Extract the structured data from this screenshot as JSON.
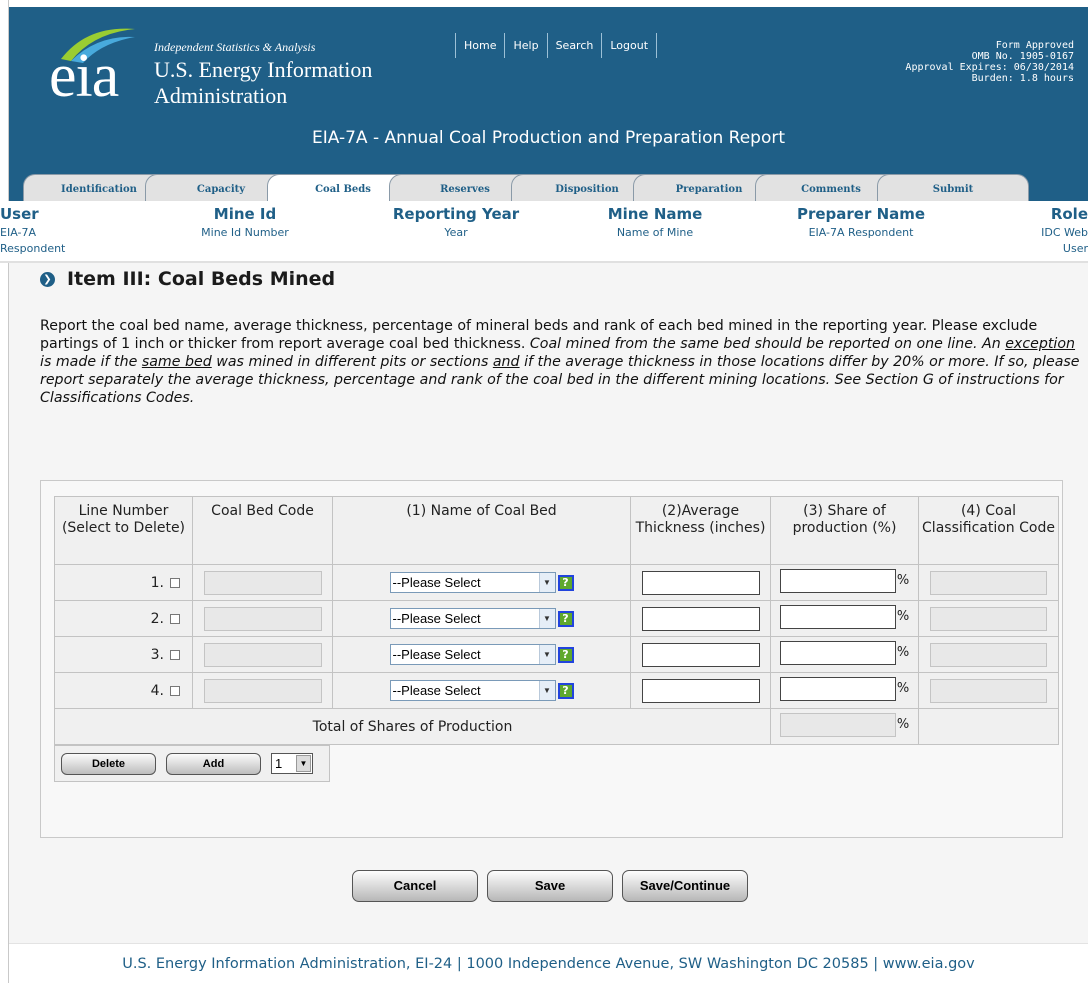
{
  "header": {
    "tagline": "Independent Statistics & Analysis",
    "org_line1": "U.S. Energy Information",
    "org_line2": "Administration",
    "logo_text": "eia",
    "nav": [
      "Home",
      "Help",
      "Search",
      "Logout"
    ],
    "approval": [
      "Form Approved",
      "OMB No. 1905-0167",
      "Approval Expires: 06/30/2014",
      "Burden: 1.8 hours"
    ],
    "form_title": "EIA-7A - Annual Coal Production and Preparation Report",
    "brand_color": "#1f5f87"
  },
  "tabs": [
    "Identification",
    "Capacity",
    "Coal Beds",
    "Reserves",
    "Disposition",
    "Preparation",
    "Comments",
    "Submit"
  ],
  "active_tab": "Coal Beds",
  "info": {
    "user_label": "User",
    "user_value1": "EIA-7A",
    "user_value2": "Respondent",
    "mine_id_label": "Mine Id",
    "mine_id_value": "Mine Id Number",
    "year_label": "Reporting Year",
    "year_value": "Year",
    "mine_name_label": "Mine Name",
    "mine_name_value": "Name of Mine",
    "preparer_label": "Preparer Name",
    "preparer_value": "EIA-7A Respondent",
    "role_label": "Role",
    "role_value1": "IDC Web",
    "role_value2": "User"
  },
  "item_title": "Item III: Coal Beds Mined",
  "instructions": {
    "p1": "Report the coal bed name, average thickness, percentage of mineral beds and rank of each bed mined in the reporting year. Please exclude partings of 1 inch or thicker from report average coal bed thickness. ",
    "p2": "Coal mined from the same bed should be reported on one line. An ",
    "u1": "exception",
    "p3": " is made if the ",
    "u2": "same bed",
    "p4": " was mined in different pits or sections ",
    "u3": "and",
    "p5": " if the average thickness in those locations differ by 20% or more. If so, please report separately the average thickness, percentage and rank of the coal bed in the different mining locations. See Section G of instructions for Classifications Codes."
  },
  "table": {
    "headers": [
      "Line Number (Select to Delete)",
      "Coal Bed Code",
      "(1) Name of Coal Bed",
      "(2)Average Thickness (inches)",
      "(3) Share of production (%)",
      "(4) Coal Classification Code"
    ],
    "rows": [
      {
        "line": "1.",
        "select": "--Please Select"
      },
      {
        "line": "2.",
        "select": "--Please Select"
      },
      {
        "line": "3.",
        "select": "--Please Select"
      },
      {
        "line": "4.",
        "select": "--Please Select"
      }
    ],
    "percent_sign": "%",
    "help_glyph": "?",
    "total_label": "Total of Shares of Production"
  },
  "row_controls": {
    "delete_label": "Delete",
    "add_label": "Add",
    "count_value": "1"
  },
  "actions": {
    "cancel_label": "Cancel",
    "save_label": "Save",
    "save_continue_label": "Save/Continue"
  },
  "footer": "U.S. Energy Information Administration, EI-24 | 1000 Independence Avenue, SW Washington DC 20585  | www.eia.gov"
}
